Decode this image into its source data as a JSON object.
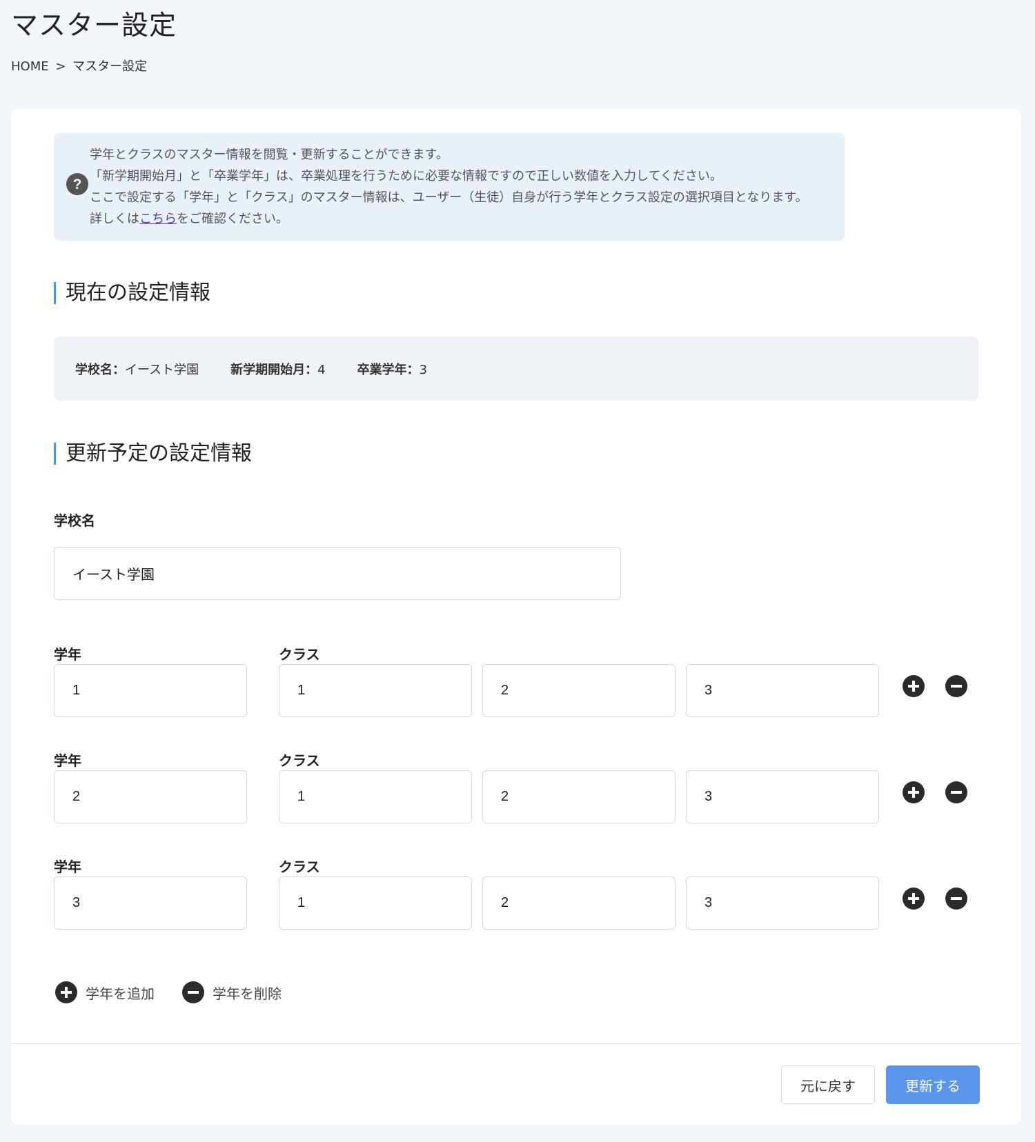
{
  "page": {
    "title": "マスター設定",
    "breadcrumb": {
      "home": "HOME",
      "separator": ">",
      "current": "マスター設定"
    }
  },
  "info": {
    "icon": "question-circle-icon",
    "line1": "学年とクラスのマスター情報を閲覧・更新することができます。",
    "line2": "「新学期開始月」と「卒業学年」は、卒業処理を行うために必要な情報ですので正しい数値を入力してください。",
    "line3": "ここで設定する「学年」と「クラス」のマスター情報は、ユーザー（生徒）自身が行う学年とクラス設定の選択項目となります。",
    "line4_prefix": "詳しくは",
    "line4_link": "こちら",
    "line4_suffix": "をご確認ください。"
  },
  "current": {
    "heading": "現在の設定情報",
    "school_label": "学校名：",
    "school_value": "イースト学園",
    "start_month_label": "新学期開始月：",
    "start_month_value": "4",
    "grad_grade_label": "卒業学年：",
    "grad_grade_value": "3"
  },
  "update": {
    "heading": "更新予定の設定情報",
    "school_label": "学校名",
    "school_value": "イースト学園",
    "grade_label": "学年",
    "class_label": "クラス",
    "rows": [
      {
        "grade": "1",
        "classes": [
          "1",
          "2",
          "3"
        ]
      },
      {
        "grade": "2",
        "classes": [
          "1",
          "2",
          "3"
        ]
      },
      {
        "grade": "3",
        "classes": [
          "1",
          "2",
          "3"
        ]
      }
    ],
    "add_grade": "学年を追加",
    "remove_grade": "学年を削除"
  },
  "actions": {
    "reset": "元に戻す",
    "submit": "更新する"
  },
  "colors": {
    "accent": "#5b95ec",
    "heading_bar": "#4f8de8",
    "info_bg": "#e9f0f7",
    "icon": "#2b2b2b"
  }
}
